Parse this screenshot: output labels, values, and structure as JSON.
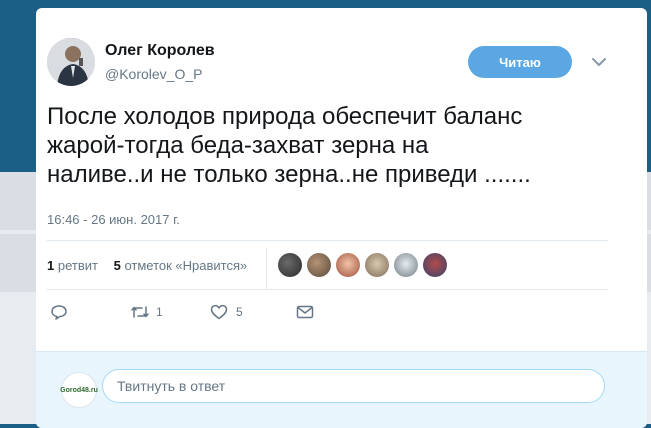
{
  "author": {
    "name": "Олег Королев",
    "handle": "@Korolev_O_P"
  },
  "follow_button": {
    "label": "Читаю"
  },
  "tweet": {
    "text": "После холодов природа обеспечит баланс\nжарой-тогда беда-захват зерна на\nналиве..и не только зерна..не приведи .......",
    "timestamp": "16:46 - 26 июн. 2017 г."
  },
  "stats": {
    "retweets_count": "1",
    "retweets_label": "ретвит",
    "likes_count": "5",
    "likes_label": "отметок «Нравится»"
  },
  "likers": [
    {
      "icon": "liker-avatar",
      "color": "#3a3a3a"
    },
    {
      "icon": "liker-avatar",
      "color": "#7b6a58"
    },
    {
      "icon": "liker-avatar",
      "color": "#c4866a"
    },
    {
      "icon": "liker-avatar",
      "color": "#a89882"
    },
    {
      "icon": "liker-avatar",
      "color": "#8e9aa0"
    },
    {
      "icon": "liker-avatar",
      "color": "#5b6f96"
    }
  ],
  "actions": {
    "reply_count": "",
    "retweet_count": "1",
    "like_count": "5"
  },
  "reply": {
    "my_avatar_text": "Gorod48.ru",
    "placeholder": "Твитнуть в ответ"
  },
  "colors": {
    "accent": "#5aa7e4",
    "backdrop": "#1b5e86"
  }
}
